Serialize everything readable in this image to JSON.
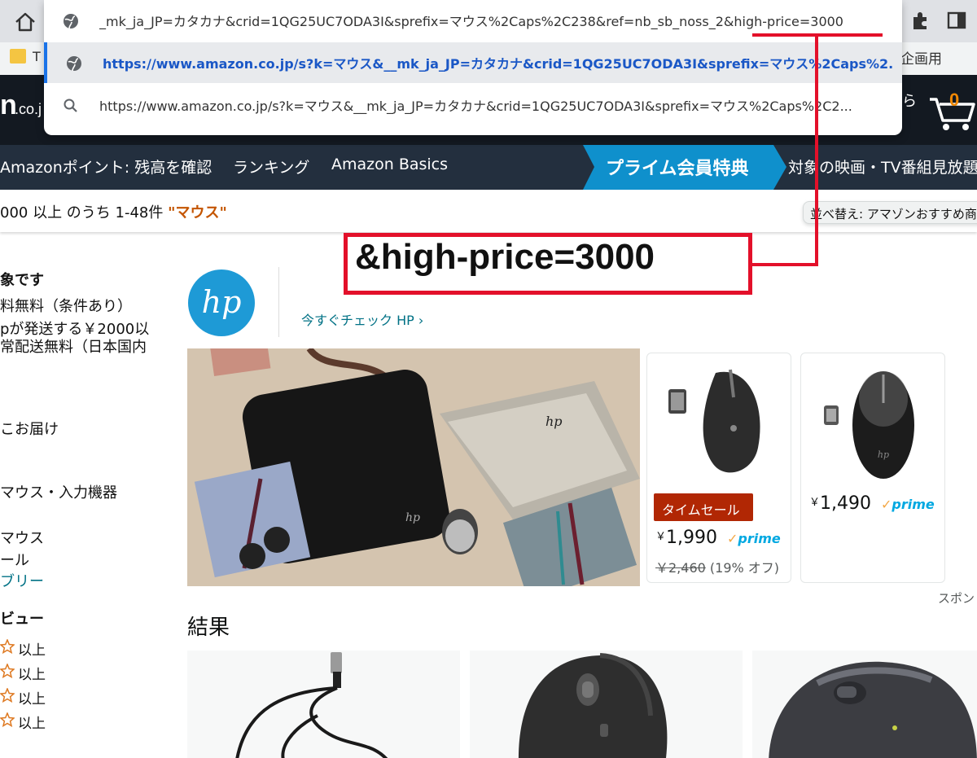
{
  "browser": {
    "omnibox_current": "_mk_ja_JP=カタカナ&crid=1QG25UC7ODA3I&sprefix=マウス%2Caps%2C238&ref=nb_sb_noss_2&high-price=3000",
    "suggestions": [
      "https://www.amazon.co.jp/s?k=マウス&__mk_ja_JP=カタカナ&crid=1QG25UC7ODA3I&sprefix=マウス%2Caps%2...",
      "https://www.amazon.co.jp/s?k=マウス&__mk_ja_JP=カタカナ&crid=1QG25UC7ODA3I&sprefix=マウス%2Caps%2C2..."
    ],
    "bookmark_left": "T",
    "bookmark_right": "企画用"
  },
  "header": {
    "logo": "n",
    "logo_sub": ".co.j",
    "right_text": "ら",
    "cart_count": "0"
  },
  "nav": {
    "items": [
      "Amazonポイント: 残高を確認",
      "ランキング",
      "Amazon Basics"
    ],
    "prime_banner": "プライム会員特典",
    "after_prime": "対象の映画・TV番組見放題"
  },
  "results": {
    "count_text": "000 以上 のうち 1-48件 ",
    "query": "\"マウス\"",
    "sort_label": "並べ替え: アマゾンおすすめ商"
  },
  "sidebar": {
    "lines": [
      {
        "text": "象です",
        "bold": true
      },
      {
        "text": "料無料（条件あり）",
        "bold": false
      },
      {
        "text": "pが発送する￥2000以",
        "bold": false
      },
      {
        "text": "常配送無料（日本国内",
        "bold": false
      },
      {
        "text": "こお届け",
        "bold": false
      },
      {
        "text": "マウス・入力機器",
        "bold": false
      },
      {
        "text": "マウス",
        "bold": false
      },
      {
        "text": "ール",
        "bold": false
      },
      {
        "text": "ブリー",
        "link": true
      },
      {
        "text": "ビュー",
        "bold": true
      }
    ],
    "ratings": [
      "以上",
      "以上",
      "以上",
      "以上"
    ]
  },
  "sponsored": {
    "brand_link": "今すぐチェック HP ›",
    "products": [
      {
        "badge": "タイムセール",
        "price": "1,990",
        "prime": "prime",
        "list_price": "￥2,460",
        "discount": "(19% オフ)"
      },
      {
        "price": "1,490",
        "prime": "prime"
      }
    ],
    "sponsored_label": "スポン"
  },
  "results_heading": "結果",
  "annotation": {
    "text": "&high-price=3000",
    "color": "#e3102a"
  },
  "colors": {
    "amazon_dark": "#131921",
    "amazon_nav": "#232f3e",
    "prime_blue": "#00a8e1",
    "deal_red": "#b12704",
    "link_teal": "#007185"
  }
}
